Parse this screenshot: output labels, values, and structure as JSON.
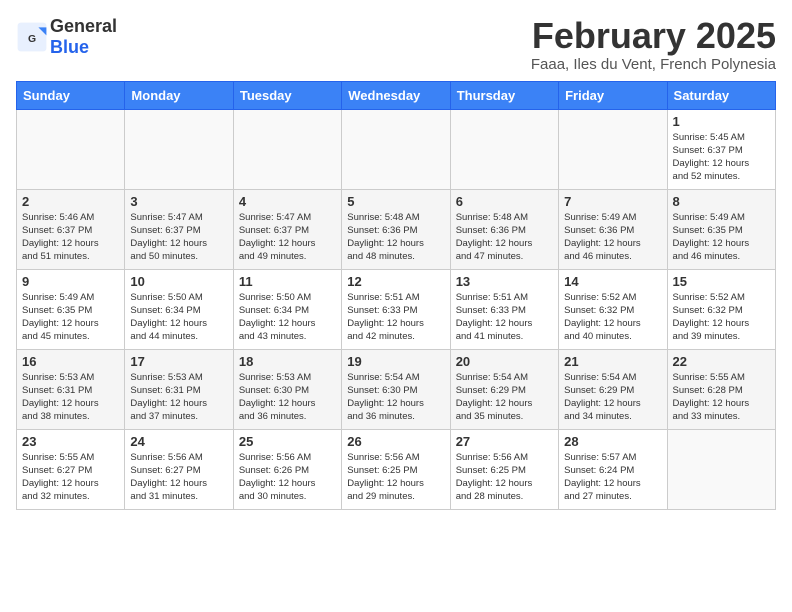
{
  "header": {
    "logo_general": "General",
    "logo_blue": "Blue",
    "month_title": "February 2025",
    "location": "Faaa, Iles du Vent, French Polynesia"
  },
  "weekdays": [
    "Sunday",
    "Monday",
    "Tuesday",
    "Wednesday",
    "Thursday",
    "Friday",
    "Saturday"
  ],
  "weeks": [
    [
      {
        "day": "",
        "info": ""
      },
      {
        "day": "",
        "info": ""
      },
      {
        "day": "",
        "info": ""
      },
      {
        "day": "",
        "info": ""
      },
      {
        "day": "",
        "info": ""
      },
      {
        "day": "",
        "info": ""
      },
      {
        "day": "1",
        "info": "Sunrise: 5:45 AM\nSunset: 6:37 PM\nDaylight: 12 hours\nand 52 minutes."
      }
    ],
    [
      {
        "day": "2",
        "info": "Sunrise: 5:46 AM\nSunset: 6:37 PM\nDaylight: 12 hours\nand 51 minutes."
      },
      {
        "day": "3",
        "info": "Sunrise: 5:47 AM\nSunset: 6:37 PM\nDaylight: 12 hours\nand 50 minutes."
      },
      {
        "day": "4",
        "info": "Sunrise: 5:47 AM\nSunset: 6:37 PM\nDaylight: 12 hours\nand 49 minutes."
      },
      {
        "day": "5",
        "info": "Sunrise: 5:48 AM\nSunset: 6:36 PM\nDaylight: 12 hours\nand 48 minutes."
      },
      {
        "day": "6",
        "info": "Sunrise: 5:48 AM\nSunset: 6:36 PM\nDaylight: 12 hours\nand 47 minutes."
      },
      {
        "day": "7",
        "info": "Sunrise: 5:49 AM\nSunset: 6:36 PM\nDaylight: 12 hours\nand 46 minutes."
      },
      {
        "day": "8",
        "info": "Sunrise: 5:49 AM\nSunset: 6:35 PM\nDaylight: 12 hours\nand 46 minutes."
      }
    ],
    [
      {
        "day": "9",
        "info": "Sunrise: 5:49 AM\nSunset: 6:35 PM\nDaylight: 12 hours\nand 45 minutes."
      },
      {
        "day": "10",
        "info": "Sunrise: 5:50 AM\nSunset: 6:34 PM\nDaylight: 12 hours\nand 44 minutes."
      },
      {
        "day": "11",
        "info": "Sunrise: 5:50 AM\nSunset: 6:34 PM\nDaylight: 12 hours\nand 43 minutes."
      },
      {
        "day": "12",
        "info": "Sunrise: 5:51 AM\nSunset: 6:33 PM\nDaylight: 12 hours\nand 42 minutes."
      },
      {
        "day": "13",
        "info": "Sunrise: 5:51 AM\nSunset: 6:33 PM\nDaylight: 12 hours\nand 41 minutes."
      },
      {
        "day": "14",
        "info": "Sunrise: 5:52 AM\nSunset: 6:32 PM\nDaylight: 12 hours\nand 40 minutes."
      },
      {
        "day": "15",
        "info": "Sunrise: 5:52 AM\nSunset: 6:32 PM\nDaylight: 12 hours\nand 39 minutes."
      }
    ],
    [
      {
        "day": "16",
        "info": "Sunrise: 5:53 AM\nSunset: 6:31 PM\nDaylight: 12 hours\nand 38 minutes."
      },
      {
        "day": "17",
        "info": "Sunrise: 5:53 AM\nSunset: 6:31 PM\nDaylight: 12 hours\nand 37 minutes."
      },
      {
        "day": "18",
        "info": "Sunrise: 5:53 AM\nSunset: 6:30 PM\nDaylight: 12 hours\nand 36 minutes."
      },
      {
        "day": "19",
        "info": "Sunrise: 5:54 AM\nSunset: 6:30 PM\nDaylight: 12 hours\nand 36 minutes."
      },
      {
        "day": "20",
        "info": "Sunrise: 5:54 AM\nSunset: 6:29 PM\nDaylight: 12 hours\nand 35 minutes."
      },
      {
        "day": "21",
        "info": "Sunrise: 5:54 AM\nSunset: 6:29 PM\nDaylight: 12 hours\nand 34 minutes."
      },
      {
        "day": "22",
        "info": "Sunrise: 5:55 AM\nSunset: 6:28 PM\nDaylight: 12 hours\nand 33 minutes."
      }
    ],
    [
      {
        "day": "23",
        "info": "Sunrise: 5:55 AM\nSunset: 6:27 PM\nDaylight: 12 hours\nand 32 minutes."
      },
      {
        "day": "24",
        "info": "Sunrise: 5:56 AM\nSunset: 6:27 PM\nDaylight: 12 hours\nand 31 minutes."
      },
      {
        "day": "25",
        "info": "Sunrise: 5:56 AM\nSunset: 6:26 PM\nDaylight: 12 hours\nand 30 minutes."
      },
      {
        "day": "26",
        "info": "Sunrise: 5:56 AM\nSunset: 6:25 PM\nDaylight: 12 hours\nand 29 minutes."
      },
      {
        "day": "27",
        "info": "Sunrise: 5:56 AM\nSunset: 6:25 PM\nDaylight: 12 hours\nand 28 minutes."
      },
      {
        "day": "28",
        "info": "Sunrise: 5:57 AM\nSunset: 6:24 PM\nDaylight: 12 hours\nand 27 minutes."
      },
      {
        "day": "",
        "info": ""
      }
    ]
  ]
}
